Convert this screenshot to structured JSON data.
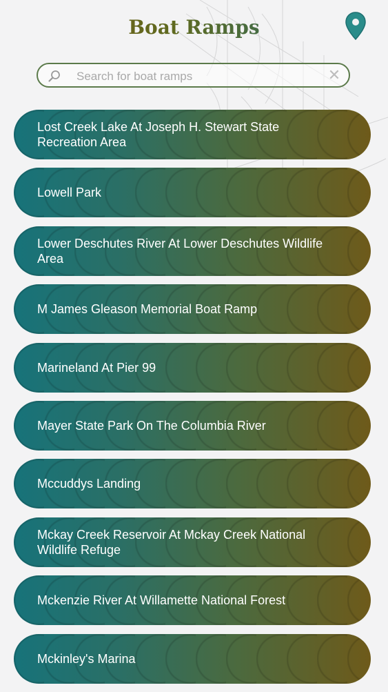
{
  "header": {
    "title": "Boat Ramps",
    "map_icon": "map-pin-icon"
  },
  "search": {
    "placeholder": "Search for boat ramps",
    "value": "",
    "search_icon": "magnifier-icon",
    "clear_icon": "clear-x-icon"
  },
  "colors": {
    "title_gold": "#7a5a12",
    "title_teal": "#1e6f78",
    "item_gradient_start": "#17737a",
    "item_gradient_end": "#6e5a1a",
    "pin_teal": "#2a8c8a"
  },
  "ramps": [
    {
      "label": "Lost Creek Lake At Joseph H. Stewart State Recreation Area"
    },
    {
      "label": "Lowell Park"
    },
    {
      "label": "Lower Deschutes River At Lower Deschutes Wildlife Area"
    },
    {
      "label": "M James Gleason Memorial Boat Ramp"
    },
    {
      "label": "Marineland At Pier 99"
    },
    {
      "label": "Mayer State Park On The Columbia River"
    },
    {
      "label": "Mccuddys Landing"
    },
    {
      "label": "Mckay Creek Reservoir At Mckay Creek National Wildlife Refuge"
    },
    {
      "label": "Mckenzie River At Willamette National Forest"
    },
    {
      "label": "Mckinley's Marina"
    }
  ]
}
